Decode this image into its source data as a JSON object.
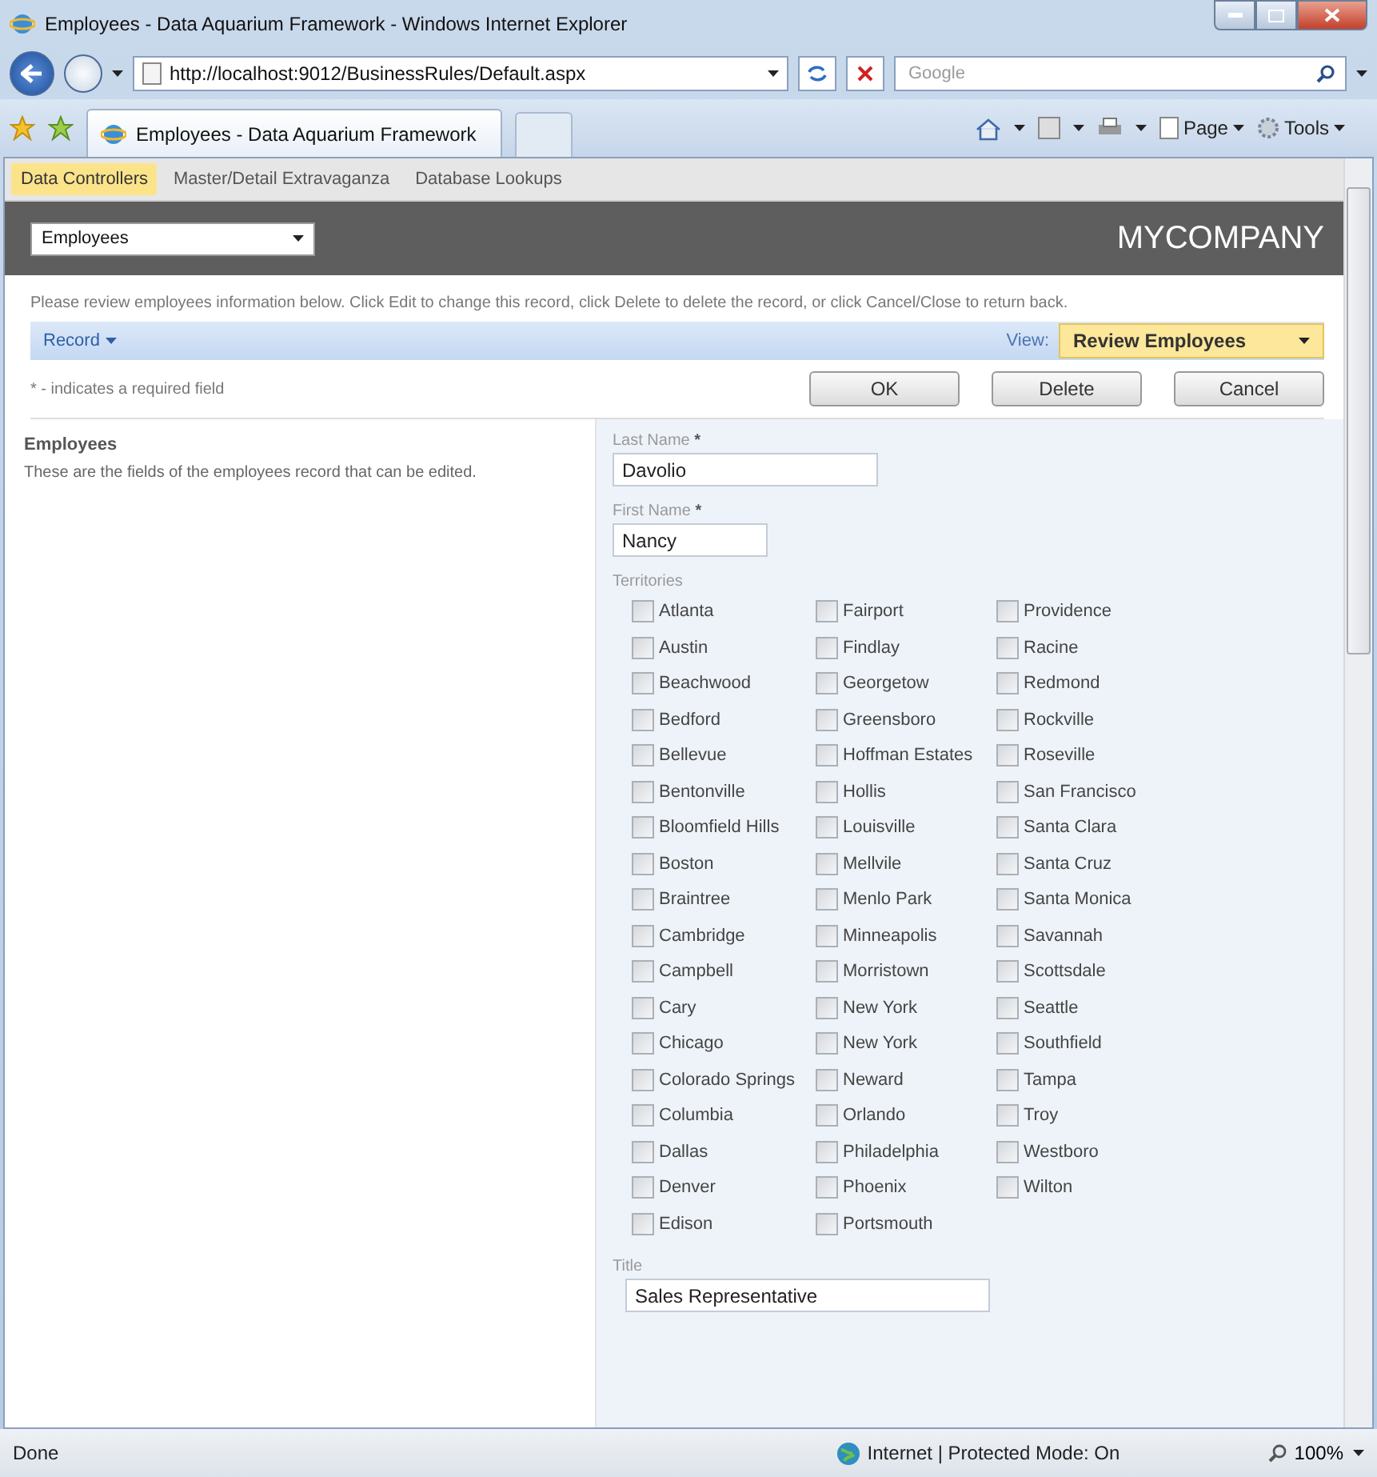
{
  "window": {
    "title": "Employees - Data Aquarium Framework - Windows Internet Explorer"
  },
  "address_bar": {
    "url": "http://localhost:9012/BusinessRules/Default.aspx"
  },
  "search": {
    "placeholder": "Google"
  },
  "browser_tab": {
    "title": "Employees - Data Aquarium Framework"
  },
  "command_bar": [
    "Page",
    "Tools"
  ],
  "page_tabs": [
    {
      "label": "Data Controllers",
      "selected": true
    },
    {
      "label": "Master/Detail Extravaganza",
      "selected": false
    },
    {
      "label": "Database Lookups",
      "selected": false
    }
  ],
  "header": {
    "controller_select": "Employees",
    "brand": "MYCOMPANY"
  },
  "instructions": "Please review employees information below. Click Edit to change this record, click Delete to delete the record, or click Cancel/Close to return back.",
  "action_bar": {
    "record_menu": "Record",
    "view_label": "View:",
    "view_select": "Review Employees"
  },
  "required_note": "* - indicates a required field",
  "buttons": [
    "OK",
    "Delete",
    "Cancel"
  ],
  "section": {
    "title": "Employees",
    "description": "These are the fields of the employees record that can be edited."
  },
  "fields": [
    {
      "kind": "text",
      "label": "Last Name",
      "required_mark": "*",
      "value": "Davolio"
    },
    {
      "kind": "text",
      "label": "First Name",
      "required_mark": "*",
      "value": "Nancy"
    },
    {
      "kind": "checklist",
      "label": "Territories",
      "columns": [
        [
          {
            "label": "Atlanta",
            "checked": false
          },
          {
            "label": "Austin",
            "checked": false
          },
          {
            "label": "Beachwood",
            "checked": false
          },
          {
            "label": "Bedford",
            "checked": false
          },
          {
            "label": "Bellevue",
            "checked": false
          },
          {
            "label": "Bentonville",
            "checked": false
          },
          {
            "label": "Bloomfield Hills",
            "checked": false
          },
          {
            "label": "Boston",
            "checked": false
          },
          {
            "label": "Braintree",
            "checked": false
          },
          {
            "label": "Cambridge",
            "checked": false
          },
          {
            "label": "Campbell",
            "checked": false
          },
          {
            "label": "Cary",
            "checked": false
          },
          {
            "label": "Chicago",
            "checked": false
          },
          {
            "label": "Colorado Springs",
            "checked": false
          },
          {
            "label": "Columbia",
            "checked": false
          },
          {
            "label": "Dallas",
            "checked": false
          },
          {
            "label": "Denver",
            "checked": false
          },
          {
            "label": "Edison",
            "checked": false
          }
        ],
        [
          {
            "label": "Fairport",
            "checked": false
          },
          {
            "label": "Findlay",
            "checked": false
          },
          {
            "label": "Georgetow",
            "checked": false
          },
          {
            "label": "Greensboro",
            "checked": false
          },
          {
            "label": "Hoffman Estates",
            "checked": false
          },
          {
            "label": "Hollis",
            "checked": false
          },
          {
            "label": "Louisville",
            "checked": false
          },
          {
            "label": "Mellvile",
            "checked": false
          },
          {
            "label": "Menlo Park",
            "checked": false
          },
          {
            "label": "Minneapolis",
            "checked": false
          },
          {
            "label": "Morristown",
            "checked": false
          },
          {
            "label": "New York",
            "checked": false
          },
          {
            "label": "New York",
            "checked": false
          },
          {
            "label": "Neward",
            "checked": false
          },
          {
            "label": "Orlando",
            "checked": false
          },
          {
            "label": "Philadelphia",
            "checked": false
          },
          {
            "label": "Phoenix",
            "checked": false
          },
          {
            "label": "Portsmouth",
            "checked": false
          }
        ],
        [
          {
            "label": "Providence",
            "checked": false
          },
          {
            "label": "Racine",
            "checked": false
          },
          {
            "label": "Redmond",
            "checked": false
          },
          {
            "label": "Rockville",
            "checked": false
          },
          {
            "label": "Roseville",
            "checked": false
          },
          {
            "label": "San Francisco",
            "checked": false
          },
          {
            "label": "Santa Clara",
            "checked": false
          },
          {
            "label": "Santa Cruz",
            "checked": false
          },
          {
            "label": "Santa Monica",
            "checked": false
          },
          {
            "label": "Savannah",
            "checked": false
          },
          {
            "label": "Scottsdale",
            "checked": false
          },
          {
            "label": "Seattle",
            "checked": false
          },
          {
            "label": "Southfield",
            "checked": false
          },
          {
            "label": "Tampa",
            "checked": false
          },
          {
            "label": "Troy",
            "checked": false
          },
          {
            "label": "Westboro",
            "checked": false
          },
          {
            "label": "Wilton",
            "checked": false
          }
        ]
      ]
    },
    {
      "kind": "text",
      "label": "Title",
      "value": "Sales Representative"
    }
  ],
  "status_bar": {
    "text": "Done",
    "zone": "Internet | Protected Mode: On",
    "zoom": "100%"
  }
}
